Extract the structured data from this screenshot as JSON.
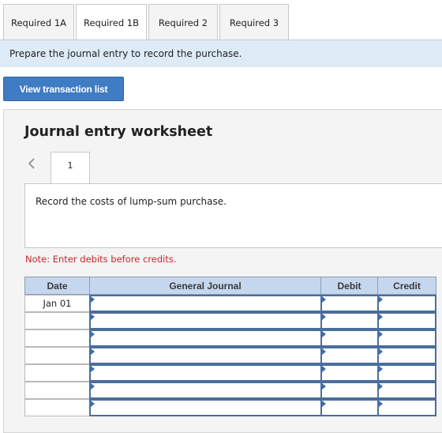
{
  "tabs": [
    {
      "label": "Required 1A",
      "active": false
    },
    {
      "label": "Required 1B",
      "active": true
    },
    {
      "label": "Required 2",
      "active": false
    },
    {
      "label": "Required 3",
      "active": false
    }
  ],
  "instruction": "Prepare the journal entry to record the purchase.",
  "view_button_label": "View transaction list",
  "worksheet": {
    "title": "Journal entry worksheet",
    "entry_tab": "1",
    "description": "Record the costs of lump-sum purchase.",
    "note": "Note: Enter debits before credits."
  },
  "table": {
    "headers": {
      "date": "Date",
      "journal": "General Journal",
      "debit": "Debit",
      "credit": "Credit"
    },
    "rows": [
      {
        "date": "Jan 01"
      },
      {
        "date": ""
      },
      {
        "date": ""
      },
      {
        "date": ""
      },
      {
        "date": ""
      },
      {
        "date": ""
      },
      {
        "date": ""
      }
    ]
  },
  "colors": {
    "accent_button": "#3f7cc3",
    "banner": "#dcebf5",
    "header": "#c5d7ee",
    "note": "#c0282b"
  }
}
